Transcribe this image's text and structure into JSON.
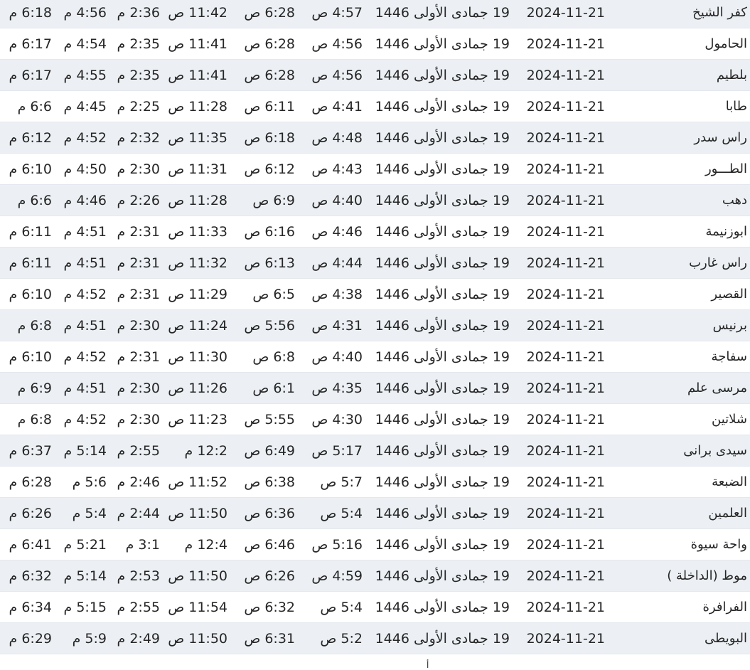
{
  "table": {
    "rows": [
      {
        "city": "كفر الشيخ",
        "date": "2024-11-21",
        "hijri": "19 جمادى الأولى 1446",
        "fajr": "4:57 ص",
        "shrouk": "6:28 ص",
        "dhuhr": "11:42 ص",
        "asr": "2:36 م",
        "maghrib": "4:56 م",
        "isha": "6:18 م"
      },
      {
        "city": "الحامول",
        "date": "2024-11-21",
        "hijri": "19 جمادى الأولى 1446",
        "fajr": "4:56 ص",
        "shrouk": "6:28 ص",
        "dhuhr": "11:41 ص",
        "asr": "2:35 م",
        "maghrib": "4:54 م",
        "isha": "6:17 م"
      },
      {
        "city": "بلطيم",
        "date": "2024-11-21",
        "hijri": "19 جمادى الأولى 1446",
        "fajr": "4:56 ص",
        "shrouk": "6:28 ص",
        "dhuhr": "11:41 ص",
        "asr": "2:35 م",
        "maghrib": "4:55 م",
        "isha": "6:17 م"
      },
      {
        "city": "طابا",
        "date": "2024-11-21",
        "hijri": "19 جمادى الأولى 1446",
        "fajr": "4:41 ص",
        "shrouk": "6:11 ص",
        "dhuhr": "11:28 ص",
        "asr": "2:25 م",
        "maghrib": "4:45 م",
        "isha": "6:6 م"
      },
      {
        "city": "راس سدر",
        "date": "2024-11-21",
        "hijri": "19 جمادى الأولى 1446",
        "fajr": "4:48 ص",
        "shrouk": "6:18 ص",
        "dhuhr": "11:35 ص",
        "asr": "2:32 م",
        "maghrib": "4:52 م",
        "isha": "6:12 م"
      },
      {
        "city": "الطـــور",
        "date": "2024-11-21",
        "hijri": "19 جمادى الأولى 1446",
        "fajr": "4:43 ص",
        "shrouk": "6:12 ص",
        "dhuhr": "11:31 ص",
        "asr": "2:30 م",
        "maghrib": "4:50 م",
        "isha": "6:10 م"
      },
      {
        "city": "دهب",
        "date": "2024-11-21",
        "hijri": "19 جمادى الأولى 1446",
        "fajr": "4:40 ص",
        "shrouk": "6:9 ص",
        "dhuhr": "11:28 ص",
        "asr": "2:26 م",
        "maghrib": "4:46 م",
        "isha": "6:6 م"
      },
      {
        "city": "ابوزنيمة",
        "date": "2024-11-21",
        "hijri": "19 جمادى الأولى 1446",
        "fajr": "4:46 ص",
        "shrouk": "6:16 ص",
        "dhuhr": "11:33 ص",
        "asr": "2:31 م",
        "maghrib": "4:51 م",
        "isha": "6:11 م"
      },
      {
        "city": "راس غارب",
        "date": "2024-11-21",
        "hijri": "19 جمادى الأولى 1446",
        "fajr": "4:44 ص",
        "shrouk": "6:13 ص",
        "dhuhr": "11:32 ص",
        "asr": "2:31 م",
        "maghrib": "4:51 م",
        "isha": "6:11 م"
      },
      {
        "city": "القصير",
        "date": "2024-11-21",
        "hijri": "19 جمادى الأولى 1446",
        "fajr": "4:38 ص",
        "shrouk": "6:5 ص",
        "dhuhr": "11:29 ص",
        "asr": "2:31 م",
        "maghrib": "4:52 م",
        "isha": "6:10 م"
      },
      {
        "city": "برنيس",
        "date": "2024-11-21",
        "hijri": "19 جمادى الأولى 1446",
        "fajr": "4:31 ص",
        "shrouk": "5:56 ص",
        "dhuhr": "11:24 ص",
        "asr": "2:30 م",
        "maghrib": "4:51 م",
        "isha": "6:8 م"
      },
      {
        "city": "سفاجة",
        "date": "2024-11-21",
        "hijri": "19 جمادى الأولى 1446",
        "fajr": "4:40 ص",
        "shrouk": "6:8 ص",
        "dhuhr": "11:30 ص",
        "asr": "2:31 م",
        "maghrib": "4:52 م",
        "isha": "6:10 م"
      },
      {
        "city": "مرسى علم",
        "date": "2024-11-21",
        "hijri": "19 جمادى الأولى 1446",
        "fajr": "4:35 ص",
        "shrouk": "6:1 ص",
        "dhuhr": "11:26 ص",
        "asr": "2:30 م",
        "maghrib": "4:51 م",
        "isha": "6:9 م"
      },
      {
        "city": "شلاتين",
        "date": "2024-11-21",
        "hijri": "19 جمادى الأولى 1446",
        "fajr": "4:30 ص",
        "shrouk": "5:55 ص",
        "dhuhr": "11:23 ص",
        "asr": "2:30 م",
        "maghrib": "4:52 م",
        "isha": "6:8 م"
      },
      {
        "city": "سيدى برانى",
        "date": "2024-11-21",
        "hijri": "19 جمادى الأولى 1446",
        "fajr": "5:17 ص",
        "shrouk": "6:49 ص",
        "dhuhr": "12:2 م",
        "asr": "2:55 م",
        "maghrib": "5:14 م",
        "isha": "6:37 م"
      },
      {
        "city": "الضبعة",
        "date": "2024-11-21",
        "hijri": "19 جمادى الأولى 1446",
        "fajr": "5:7 ص",
        "shrouk": "6:38 ص",
        "dhuhr": "11:52 ص",
        "asr": "2:46 م",
        "maghrib": "5:6 م",
        "isha": "6:28 م"
      },
      {
        "city": "العلمين",
        "date": "2024-11-21",
        "hijri": "19 جمادى الأولى 1446",
        "fajr": "5:4 ص",
        "shrouk": "6:36 ص",
        "dhuhr": "11:50 ص",
        "asr": "2:44 م",
        "maghrib": "5:4 م",
        "isha": "6:26 م"
      },
      {
        "city": "واحة سيوة",
        "date": "2024-11-21",
        "hijri": "19 جمادى الأولى 1446",
        "fajr": "5:16 ص",
        "shrouk": "6:46 ص",
        "dhuhr": "12:4 م",
        "asr": "3:1 م",
        "maghrib": "5:21 م",
        "isha": "6:41 م"
      },
      {
        "city": "موط (الداخلة )",
        "date": "2024-11-21",
        "hijri": "19 جمادى الأولى 1446",
        "fajr": "4:59 ص",
        "shrouk": "6:26 ص",
        "dhuhr": "11:50 ص",
        "asr": "2:53 م",
        "maghrib": "5:14 م",
        "isha": "6:32 م"
      },
      {
        "city": "الفرافرة",
        "date": "2024-11-21",
        "hijri": "19 جمادى الأولى 1446",
        "fajr": "5:4 ص",
        "shrouk": "6:32 ص",
        "dhuhr": "11:54 ص",
        "asr": "2:55 م",
        "maghrib": "5:15 م",
        "isha": "6:34 م"
      },
      {
        "city": "البويطى",
        "date": "2024-11-21",
        "hijri": "19 جمادى الأولى 1446",
        "fajr": "5:2 ص",
        "shrouk": "6:31 ص",
        "dhuhr": "11:50 ص",
        "asr": "2:49 م",
        "maghrib": "5:9 م",
        "isha": "6:29 م"
      }
    ]
  },
  "trailing_fragment": "أ"
}
